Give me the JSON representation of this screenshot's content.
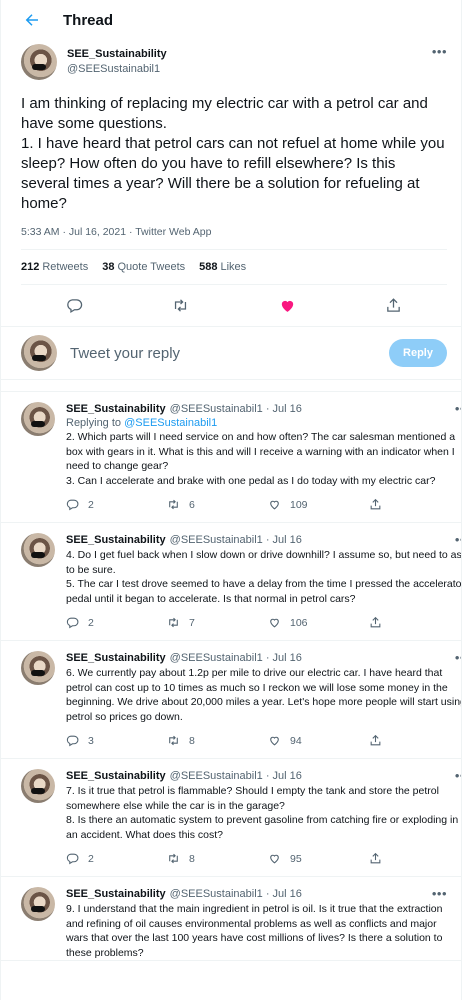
{
  "header": {
    "title": "Thread"
  },
  "main_tweet": {
    "display_name": "SEE_Sustainability",
    "handle": "@SEESustainabil1",
    "text": "I am thinking of replacing my electric car with a petrol car and have some questions.\n1. I have heard that petrol cars can not refuel at home while you sleep? How often do you have to refill elsewhere? Is this several times a year? Will there be a solution for refueling at home?",
    "timestamp": "5:33 AM · Jul 16, 2021 · Twitter Web App",
    "retweets_count": "212",
    "retweets_label": "Retweets",
    "quotes_count": "38",
    "quotes_label": "Quote Tweets",
    "likes_count": "588",
    "likes_label": "Likes"
  },
  "compose": {
    "placeholder": "Tweet your reply",
    "button_label": "Reply"
  },
  "replies": [
    {
      "display_name": "SEE_Sustainability",
      "meta": "@SEESustainabil1 · Jul 16",
      "replying_prefix": "Replying to",
      "replying_to": "@SEESustainabil1",
      "text": "2. Which parts will I need service on and how often? The car salesman mentioned a box with gears in it. What is this and will I receive a warning with an indicator when I need to change gear?\n3. Can I accelerate and brake with one pedal as I do today with my electric car?",
      "replies": "2",
      "retweets": "6",
      "likes": "109"
    },
    {
      "display_name": "SEE_Sustainability",
      "meta": "@SEESustainabil1 · Jul 16",
      "text": "4. Do I get fuel back when I slow down or drive downhill? I assume so, but need to ask to be sure.\n5. The car I test drove seemed to have a delay from the time I pressed the accelerator pedal until it began to accelerate. Is that normal in petrol cars?",
      "replies": "2",
      "retweets": "7",
      "likes": "106"
    },
    {
      "display_name": "SEE_Sustainability",
      "meta": "@SEESustainabil1 · Jul 16",
      "text": "6. We currently pay about 1.2p per mile to drive our electric car. I have heard that petrol can cost up to 10 times as much so I reckon we will lose some money in the beginning. We drive about 20,000 miles a year. Let's hope more people will start using petrol so prices go down.",
      "replies": "3",
      "retweets": "8",
      "likes": "94"
    },
    {
      "display_name": "SEE_Sustainability",
      "meta": "@SEESustainabil1 · Jul 16",
      "text": "7. Is it true that petrol is flammable? Should I empty the tank and store the petrol somewhere else while the car is in the garage?\n8. Is there an automatic system to prevent gasoline from catching fire or exploding in an accident. What does this cost?",
      "replies": "2",
      "retweets": "8",
      "likes": "95"
    },
    {
      "display_name": "SEE_Sustainability",
      "meta": "@SEESustainabil1 · Jul 16",
      "text": "9. I understand that the main ingredient in petrol is oil. Is it true that the extraction and refining of oil causes environmental problems as well as conflicts and major wars that over the last 100 years have cost millions of lives? Is there a solution to these problems?"
    }
  ],
  "colors": {
    "accent": "#1d9bf0",
    "like": "#f91880",
    "reply_button": "#8ecdf8",
    "muted": "#536471"
  }
}
